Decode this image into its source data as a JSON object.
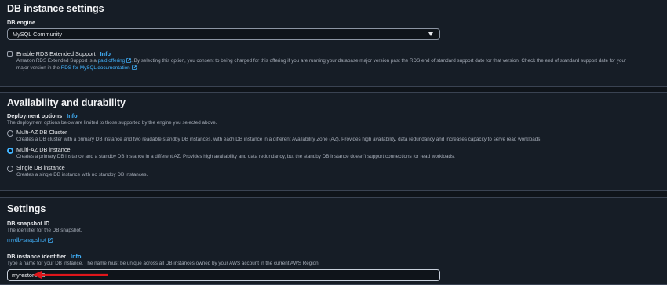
{
  "db_settings": {
    "heading": "DB instance settings",
    "engine_label": "DB engine",
    "engine_value": "MySQL Community",
    "extended_support": {
      "label": "Enable RDS Extended Support",
      "info": "Info",
      "desc_part1": "Amazon RDS Extended Support is a ",
      "paid_offering": "paid offering",
      "desc_part2": ". By selecting this option, you consent to being charged for this offering if you are running your database major version past the RDS end of standard support date for that version. Check the end of standard support date for your",
      "desc_part3": "major version in the ",
      "docs_link": "RDS for MySQL documentation",
      "desc_end": "."
    }
  },
  "availability": {
    "heading": "Availability and durability",
    "deployment_label": "Deployment options",
    "info": "Info",
    "deployment_desc": "The deployment options below are limited to those supported by the engine you selected above.",
    "options": [
      {
        "title": "Multi-AZ DB Cluster",
        "desc": "Creates a DB cluster with a primary DB instance and two readable standby DB instances, with each DB instance in a different Availability Zone (AZ). Provides high availability, data redundancy and increases capacity to serve read workloads."
      },
      {
        "title": "Multi-AZ DB instance",
        "desc": "Creates a primary DB instance and a standby DB instance in a different AZ. Provides high availability and data redundancy, but the standby DB instance doesn't support connections for read workloads."
      },
      {
        "title": "Single DB instance",
        "desc": "Creates a single DB instance with no standby DB instances."
      }
    ],
    "selected": "Multi-AZ DB instance"
  },
  "settings": {
    "heading": "Settings",
    "snapshot_label": "DB snapshot ID",
    "snapshot_desc": "The identifier for the DB snapshot.",
    "snapshot_value": "mydb-snapshot",
    "identifier_label": "DB instance identifier",
    "info": "Info",
    "identifier_desc": "Type a name for your DB instance. The name must be unique across all DB instances owned by your AWS account in the current AWS Region.",
    "identifier_value": "myrestoreDB"
  },
  "colors": {
    "accent": "#42b4ff",
    "arrow": "#e0161b",
    "panel": "#161d26",
    "page": "#0f141a"
  }
}
